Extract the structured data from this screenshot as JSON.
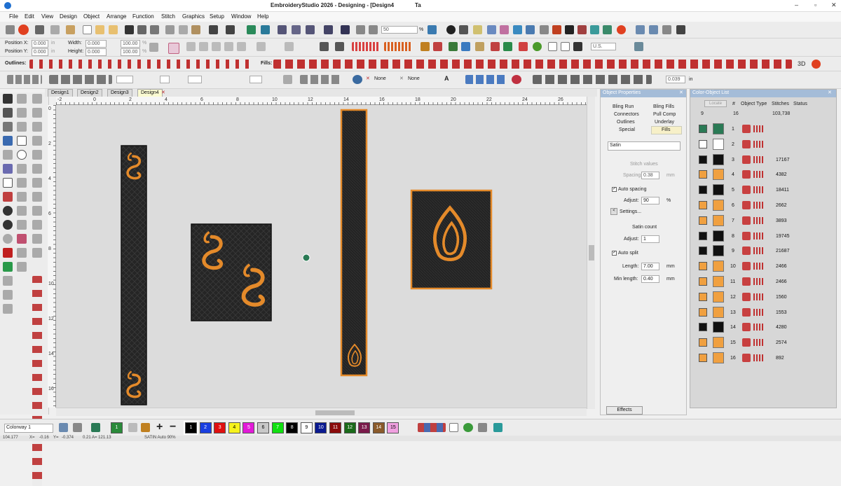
{
  "title": {
    "text": "EmbroideryStudio 2026 - Designing - [Design4",
    "extra": "Ta"
  },
  "window_controls": {
    "min": "–",
    "max": "▫",
    "close": "✕"
  },
  "menu": [
    "File",
    "Edit",
    "View",
    "Design",
    "Object",
    "Arrange",
    "Function",
    "Stitch",
    "Graphics",
    "Setup",
    "Window",
    "Help"
  ],
  "toolbar": {
    "zoom_value": "50",
    "zoom_unit": "%",
    "units": "U.S."
  },
  "position": {
    "x_label": "Position X:",
    "x_value": "0.000",
    "y_label": "Position Y:",
    "y_value": "0.000",
    "in1": "in",
    "in2": "in",
    "width_label": "Width:",
    "width_value": "0.000",
    "height_label": "Height:",
    "height_value": "0.000",
    "w_pct": "100.00",
    "h_pct": "100.00",
    "pct1": "%",
    "pct2": "%"
  },
  "outlines_label": "Outlines:",
  "fills_label": "Fills:",
  "toolbar3": {
    "none1": "None",
    "none2": "None",
    "a_label": "A",
    "size_value": "0.039",
    "size_unit": "in",
    "threed": "3D"
  },
  "tabs": [
    "Design1",
    "Design2",
    "Design3",
    "Design4"
  ],
  "ruler_h": [
    "-2",
    "0",
    "2",
    "4",
    "6",
    "8",
    "10",
    "12",
    "14",
    "16",
    "18",
    "20",
    "22",
    "24",
    "26"
  ],
  "ruler_v": [
    "0",
    "2",
    "4",
    "6",
    "8",
    "10",
    "12",
    "14",
    "16"
  ],
  "object_properties": {
    "title": "Object Properties",
    "tabs": [
      "Bling Run",
      "Bling Fills",
      "Connectors",
      "Pull Comp",
      "Outlines",
      "Underlay",
      "Special",
      "Fills"
    ],
    "fill_type": "Satin",
    "stitch_values": "Stitch values",
    "spacing_label": "Spacing:",
    "spacing_value": "0.38",
    "spacing_unit": "mm",
    "auto_spacing": "Auto spacing",
    "adjust_label": "Adjust:",
    "adjust_value": "90",
    "adjust_unit": "%",
    "settings": "Settings...",
    "satin_count": "Satin count",
    "adjust2_label": "Adjust:",
    "adjust2_value": "1",
    "auto_split": "Auto split",
    "length_label": "Length:",
    "length_value": "7.00",
    "length_unit": "mm",
    "minlen_label": "Min length:",
    "minlen_value": "0.40",
    "minlen_unit": "mm",
    "effects": "Effects"
  },
  "color_list": {
    "title": "Color-Object List",
    "columns": [
      "Locate",
      "#",
      "Object Type",
      "Stitches",
      "Status"
    ],
    "count": "9",
    "total_index": "16",
    "total_stitches": "103,738",
    "rows": [
      {
        "n": "1",
        "stitches": "",
        "color": "#2a7a55"
      },
      {
        "n": "2",
        "stitches": "",
        "color": "#ffffff"
      },
      {
        "n": "3",
        "stitches": "17167",
        "color": "#111111"
      },
      {
        "n": "4",
        "stitches": "4382",
        "color": "#f0a040"
      },
      {
        "n": "5",
        "stitches": "18411",
        "color": "#111111"
      },
      {
        "n": "6",
        "stitches": "2662",
        "color": "#f0a040"
      },
      {
        "n": "7",
        "stitches": "3893",
        "color": "#f0a040"
      },
      {
        "n": "8",
        "stitches": "19745",
        "color": "#111111"
      },
      {
        "n": "9",
        "stitches": "21687",
        "color": "#111111"
      },
      {
        "n": "10",
        "stitches": "2466",
        "color": "#f0a040"
      },
      {
        "n": "11",
        "stitches": "2466",
        "color": "#f0a040"
      },
      {
        "n": "12",
        "stitches": "1560",
        "color": "#f0a040"
      },
      {
        "n": "13",
        "stitches": "1553",
        "color": "#f0a040"
      },
      {
        "n": "14",
        "stitches": "4280",
        "color": "#111111"
      },
      {
        "n": "15",
        "stitches": "2574",
        "color": "#f0a040"
      },
      {
        "n": "16",
        "stitches": "892",
        "color": "#f0a040"
      }
    ]
  },
  "colorway": "Colorway 1",
  "palette": [
    {
      "n": "1",
      "c": "#000000"
    },
    {
      "n": "2",
      "c": "#1a3fe0"
    },
    {
      "n": "3",
      "c": "#e01010"
    },
    {
      "n": "4",
      "c": "#f6f21c"
    },
    {
      "n": "5",
      "c": "#e21ad8"
    },
    {
      "n": "6",
      "c": "#c8c8c8"
    },
    {
      "n": "7",
      "c": "#10e010"
    },
    {
      "n": "8",
      "c": "#000000"
    },
    {
      "n": "9",
      "c": "#ffffff"
    },
    {
      "n": "10",
      "c": "#0a1a90"
    },
    {
      "n": "11",
      "c": "#8a0a0a"
    },
    {
      "n": "12",
      "c": "#1a6a1a"
    },
    {
      "n": "13",
      "c": "#7a1a4a"
    },
    {
      "n": "14",
      "c": "#8a5a2a"
    },
    {
      "n": "15",
      "c": "#f0a0e0"
    }
  ],
  "status": {
    "pos": "104.177",
    "x": "X=",
    "x_val": "-0.16",
    "y": "Y=",
    "y_val": "-0.374",
    "coords": "0.21 A= 121.13",
    "mode": "SATIN Auto 90%"
  },
  "colors": {
    "accent": "#e48a2a",
    "fabric": "#222222",
    "selection": "#f0a040",
    "panel_head": "#a4bcd8"
  }
}
